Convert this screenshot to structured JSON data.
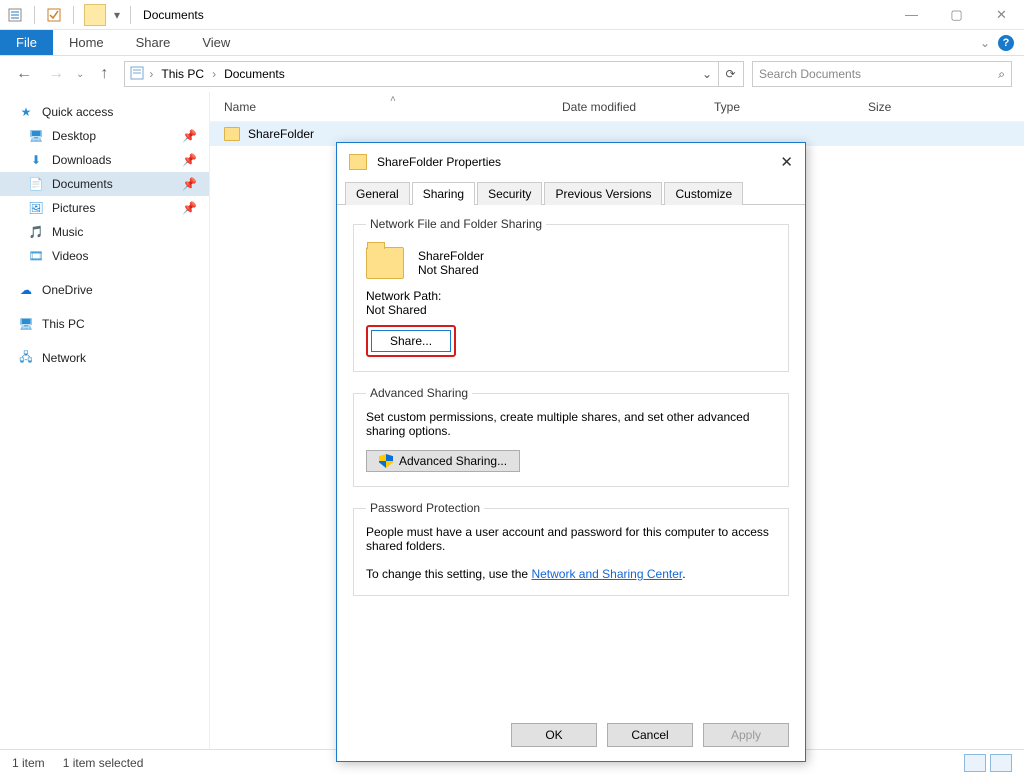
{
  "window": {
    "title": "Documents",
    "minimize": "—",
    "maximize": "▢",
    "close": "✕"
  },
  "ribbon": {
    "file": "File",
    "tabs": [
      "Home",
      "Share",
      "View"
    ],
    "chevron": "⌄"
  },
  "nav": {
    "back": "←",
    "forward": "→",
    "up": "↑",
    "drop": "⌄",
    "breadcrumb": [
      "This PC",
      "Documents"
    ],
    "chev": "›",
    "refresh": "⟳",
    "search_placeholder": "Search Documents",
    "search_icon": "⌕"
  },
  "sidebar": {
    "quick_access": "Quick access",
    "items": [
      {
        "icon": "🖥",
        "label": "Desktop",
        "pin": true
      },
      {
        "icon": "⬇",
        "label": "Downloads",
        "pin": true
      },
      {
        "icon": "📄",
        "label": "Documents",
        "pin": true,
        "selected": true
      },
      {
        "icon": "🖼",
        "label": "Pictures",
        "pin": true
      },
      {
        "icon": "🎵",
        "label": "Music",
        "pin": false
      },
      {
        "icon": "🎞",
        "label": "Videos",
        "pin": false
      }
    ],
    "onedrive": {
      "icon": "☁",
      "label": "OneDrive"
    },
    "thispc": {
      "icon": "🖥",
      "label": "This PC"
    },
    "network": {
      "icon": "🖧",
      "label": "Network"
    },
    "star": "★",
    "pin_glyph": "📌"
  },
  "columns": {
    "name": "Name",
    "date": "Date modified",
    "type": "Type",
    "size": "Size",
    "sort_up": "˄"
  },
  "files": [
    {
      "name": "ShareFolder"
    }
  ],
  "statusbar": {
    "count": "1 item",
    "selected": "1 item selected"
  },
  "dialog": {
    "title": "ShareFolder Properties",
    "close": "✕",
    "tabs": [
      "General",
      "Sharing",
      "Security",
      "Previous Versions",
      "Customize"
    ],
    "active_tab": 1,
    "nfs": {
      "legend": "Network File and Folder Sharing",
      "folder_name": "ShareFolder",
      "status": "Not Shared",
      "path_label": "Network Path:",
      "path_value": "Not Shared",
      "share_btn": "Share..."
    },
    "adv": {
      "legend": "Advanced Sharing",
      "desc": "Set custom permissions, create multiple shares, and set other advanced sharing options.",
      "btn": "Advanced Sharing..."
    },
    "pwd": {
      "legend": "Password Protection",
      "desc": "People must have a user account and password for this computer to access shared folders.",
      "change_prefix": "To change this setting, use the ",
      "link": "Network and Sharing Center",
      "suffix": "."
    },
    "buttons": {
      "ok": "OK",
      "cancel": "Cancel",
      "apply": "Apply"
    }
  }
}
